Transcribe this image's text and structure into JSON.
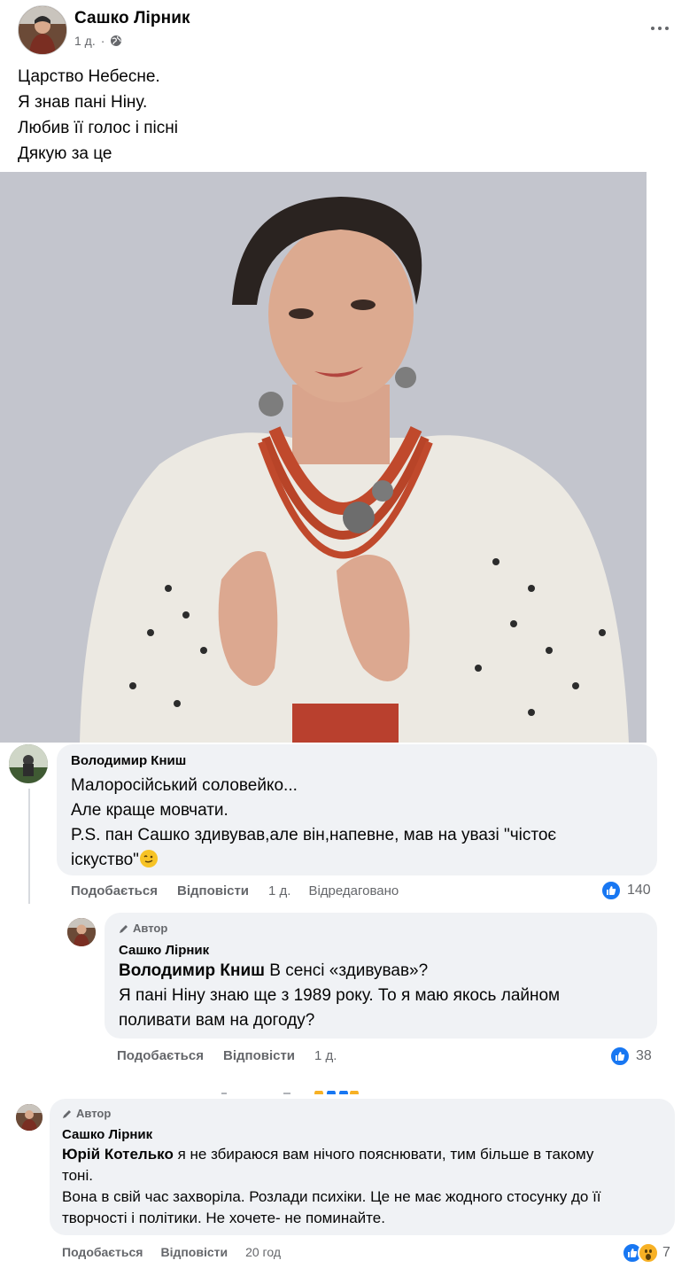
{
  "post": {
    "author": "Сашко Лірник",
    "time": "1 д.",
    "separator": "·",
    "lines": [
      "Царство Небесне.",
      "Я знав пані Ніну.",
      "Любив її голос і пісні",
      "Дякую за це"
    ]
  },
  "comments": [
    {
      "author": "Володимир Книш",
      "lines": [
        "Малоросійський соловейко...",
        "Але краще мовчати.",
        "P.S. пан Сашко здивував,але він,напевне, мав на увазі \"чістоє",
        "іскуство\""
      ],
      "like_label": "Подобається",
      "reply_label": "Відповісти",
      "time": "1 д.",
      "edited": "Відредаговано",
      "reaction_count": "140"
    },
    {
      "badge": "Автор",
      "author": "Сашко Лірник",
      "mention": "Володимир Книш",
      "lines": [
        " В сенсі «здивував»?",
        "Я пані Ніну знаю ще з 1989 року. То я маю якось лайном",
        "поливати вам на догоду?"
      ],
      "like_label": "Подобається",
      "reply_label": "Відповісти",
      "time": "1 д.",
      "reaction_count": "38"
    },
    {
      "badge": "Автор",
      "author": "Сашко Лірник",
      "mention": "Юрій Котелько",
      "lines": [
        " я не збираюся вам нічого пояснювати, тим більше в такому",
        "тоні.",
        "Вона в свій час захворіла. Розлади психіки. Це не має жодного стосунку до її",
        "творчості і політики. Не хочете- не поминайте."
      ],
      "like_label": "Подобається",
      "reply_label": "Відповісти",
      "time": "20 год",
      "reaction_count": "7"
    }
  ],
  "colors": {
    "secondary_text": "#65676b",
    "bubble_bg": "#f0f2f5",
    "like_blue": "#1877f2",
    "wow_yellow": "#f7b125"
  }
}
